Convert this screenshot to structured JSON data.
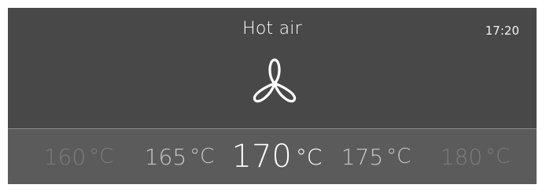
{
  "header": {
    "mode_title": "Hot air",
    "clock": "17:20",
    "mode_icon": "fan-icon"
  },
  "temperature_selector": {
    "unit": "°C",
    "options": [
      {
        "value": "160",
        "state": "far"
      },
      {
        "value": "165",
        "state": "near"
      },
      {
        "value": "170",
        "state": "selected"
      },
      {
        "value": "175",
        "state": "near"
      },
      {
        "value": "180",
        "state": "far"
      }
    ],
    "selected_value": "170"
  },
  "colors": {
    "top_background": "#484848",
    "selector_background": "#5b5b5b",
    "selected_text": "#ffffff",
    "near_text": "#c9c9c9",
    "far_text": "#7c7c7c"
  }
}
